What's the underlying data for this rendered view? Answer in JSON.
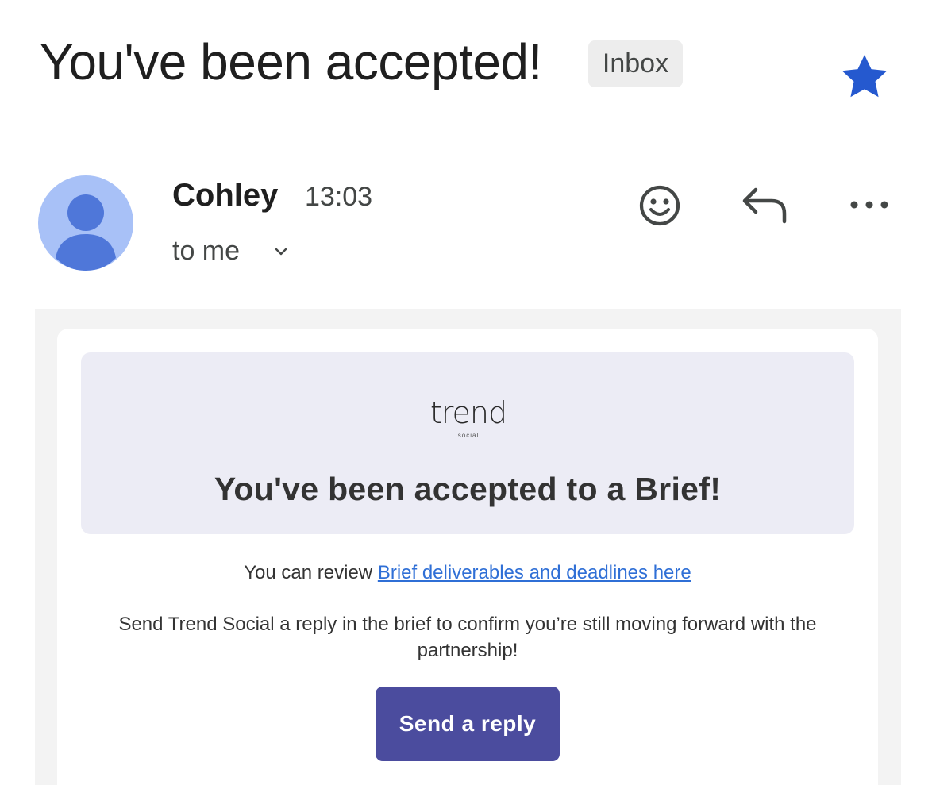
{
  "subject": {
    "title": "You've been accepted!",
    "label_chip": "Inbox",
    "star_icon": "star-icon",
    "star_color": "#2559cf"
  },
  "sender": {
    "avatar_icon": "person-icon",
    "name": "Cohley",
    "time": "13:03",
    "recipient": "to me",
    "expand_icon": "chevron-down-icon"
  },
  "actions": {
    "emoji_icon": "smiley-icon",
    "reply_icon": "reply-arrow-icon",
    "more_icon": "more-horizontal-icon"
  },
  "email_body": {
    "logo_word": "trend",
    "logo_sub": "social",
    "headline": "You've been accepted to a Brief!",
    "review_prefix": "You can review ",
    "review_link": "Brief deliverables and deadlines here",
    "paragraph": "Send Trend Social a reply in the brief to confirm you’re still moving forward with the partnership!",
    "cta_label": "Send a reply",
    "cta_color": "#4b4c9e",
    "link_color": "#2f6fd6"
  }
}
